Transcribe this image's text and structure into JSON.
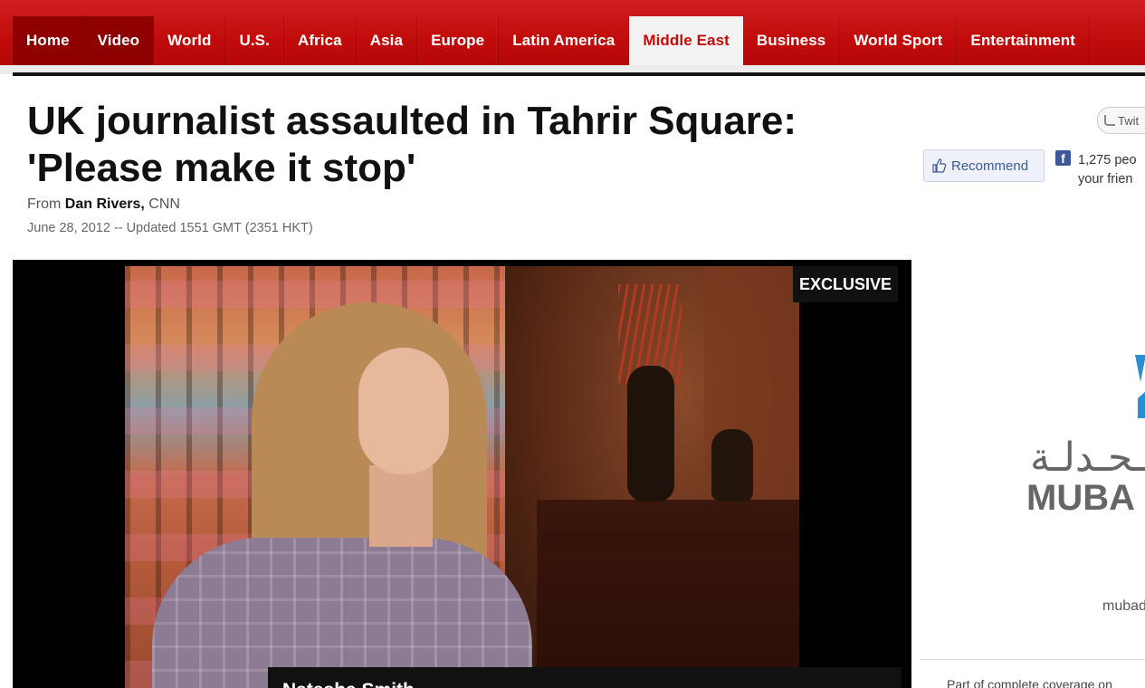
{
  "nav": {
    "items": [
      {
        "label": "Home"
      },
      {
        "label": "Video"
      },
      {
        "label": "World"
      },
      {
        "label": "U.S."
      },
      {
        "label": "Africa"
      },
      {
        "label": "Asia"
      },
      {
        "label": "Europe"
      },
      {
        "label": "Latin America"
      },
      {
        "label": "Middle East"
      },
      {
        "label": "Business"
      },
      {
        "label": "World Sport"
      },
      {
        "label": "Entertainment"
      }
    ],
    "active": "Middle East"
  },
  "article": {
    "headline_line1": "UK journalist assaulted in Tahrir Square:",
    "headline_line2": "'Please make it stop'",
    "byline_prefix": "From",
    "author": "Dan Rivers,",
    "source": "CNN",
    "dateline": "June 28, 2012 -- Updated 1551 GMT (2351 HKT)"
  },
  "video": {
    "badge": "EXCLUSIVE",
    "lower_third": "Natasha Smith"
  },
  "social": {
    "tweet_label": "Twit",
    "recommend_label": "Recommend",
    "fb_line1": "1,275 peo",
    "fb_line2": "your frien"
  },
  "ad": {
    "arabic_text": "ـحـدلـة",
    "latin_text": "MUBA",
    "url": "mubad"
  },
  "sidebar": {
    "coverage_text": "Part of complete coverage on"
  },
  "colors": {
    "nav_red": "#c20c0c",
    "nav_active_bg": "#f3f3f3",
    "facebook_blue": "#3b5998"
  },
  "icons": [
    "twitter-icon",
    "thumbs-up-icon",
    "facebook-icon"
  ]
}
